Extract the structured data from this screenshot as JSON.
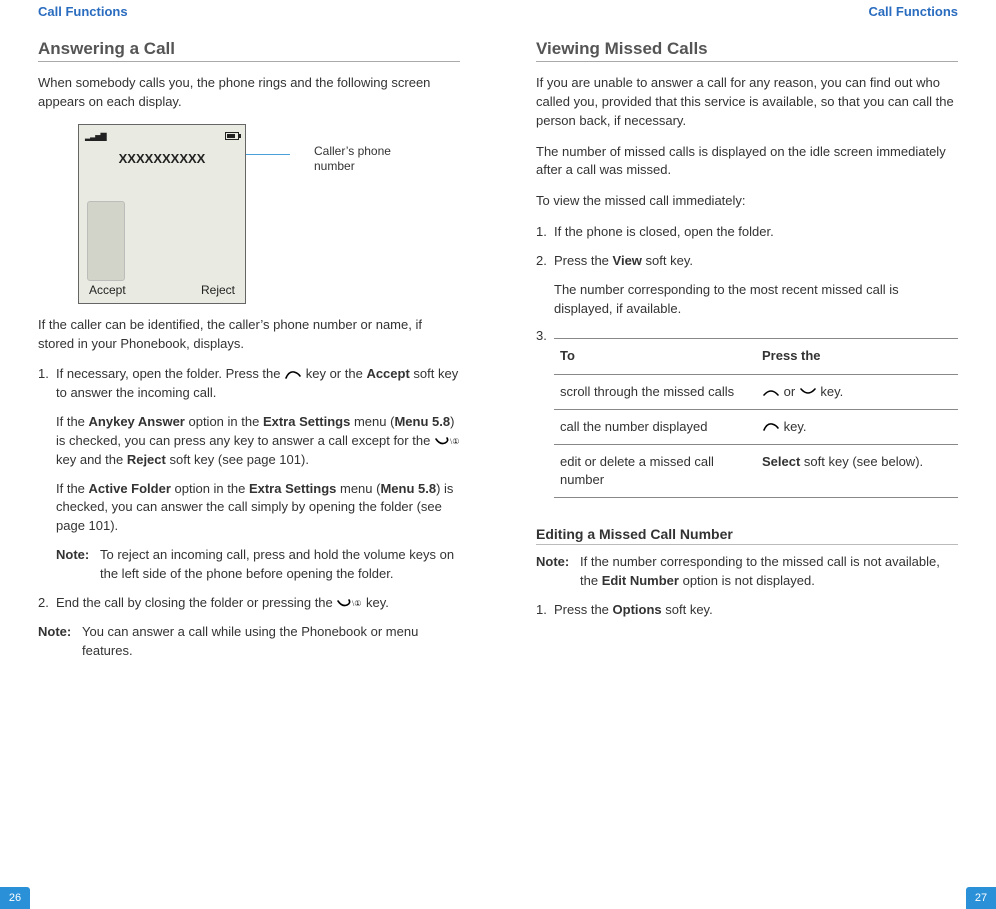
{
  "left": {
    "header": "Call Functions",
    "pageNumber": "26",
    "title": "Answering a Call",
    "intro": "When somebody calls you, the phone rings and the following screen appears on each display.",
    "phone": {
      "callerNumber": "XXXXXXXXXX",
      "softkeyLeft": "Accept",
      "softkeyRight": "Reject",
      "calloutLine1": "Caller’s phone",
      "calloutLine2": "number"
    },
    "afterPhone": "If the caller can be identified, the caller’s phone number or name, if stored in your Phonebook, displays.",
    "step1_a": "If necessary, open the folder. Press the ",
    "step1_b": " key or the ",
    "step1_accept": "Accept",
    "step1_c": " soft key to answer the incoming call.",
    "anykey_a": "If the ",
    "anykey_b": "Anykey Answer",
    "anykey_c": " option in the ",
    "anykey_d": "Extra Settings",
    "anykey_e": " menu (",
    "anykey_f": "Menu 5.8",
    "anykey_g": ") is checked, you can press any key to answer a call except for the ",
    "anykey_h": " key and the ",
    "anykey_reject": "Reject",
    "anykey_i": " soft key (see page 101).",
    "active_a": "If the ",
    "active_b": "Active Folder",
    "active_c": " option in the ",
    "active_d": "Extra Settings",
    "active_e": " menu (",
    "active_f": "Menu 5.8",
    "active_g": ") is checked, you can answer the call simply by opening the folder (see page 101).",
    "note1_label": "Note:",
    "note1_text": "To reject an incoming call, press and hold the volume keys on the left side of the phone before opening the folder.",
    "step2_a": "End the call by closing the folder or pressing the ",
    "step2_b": " key.",
    "note2_label": "Note:",
    "note2_text": "You can answer a call while using the Phonebook or menu features."
  },
  "right": {
    "header": "Call Functions",
    "pageNumber": "27",
    "title": "Viewing Missed Calls",
    "p1": "If you are unable to answer a call for any reason, you can find out who called you, provided that this service is available, so that you can call the person back, if necessary.",
    "p2": "The number of missed calls is displayed on the idle screen immediately after a call was missed.",
    "p3": "To view the missed call immediately:",
    "step1": "If the phone is closed, open the folder.",
    "step2_a": "Press the ",
    "step2_view": "View",
    "step2_b": " soft key.",
    "step2_detail": "The number corresponding to the most recent missed call is displayed, if available.",
    "tableLead": "3.",
    "th_to": "To",
    "th_press": "Press the",
    "r1c1": "scroll through the missed calls",
    "r1c2_a": " or ",
    "r1c2_b": "  key.",
    "r2c1": "call the number displayed",
    "r2c2": " key.",
    "r3c1": "edit or delete a missed call number",
    "r3c2_a": "Select",
    "r3c2_b": " soft key (see below).",
    "subTitle": "Editing a Missed Call Number",
    "note_label": "Note:",
    "note_a": "If the number corresponding to the missed call is not available, the ",
    "note_b": "Edit Number",
    "note_c": " option is not displayed.",
    "edstep1_a": "Press the ",
    "edstep1_b": "Options",
    "edstep1_c": " soft key."
  }
}
